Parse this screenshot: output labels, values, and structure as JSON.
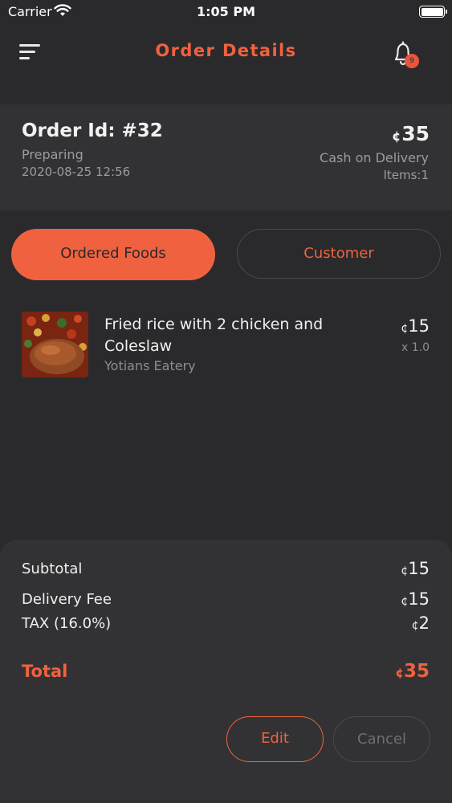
{
  "status_bar": {
    "carrier": "Carrier",
    "time": "1:05 PM",
    "icons": [
      "wifi-icon",
      "battery-icon"
    ]
  },
  "header": {
    "title": "Order Details",
    "notification_count": "9",
    "icons": [
      "menu-icon",
      "bell-icon"
    ]
  },
  "order": {
    "id_label": "Order Id: #32",
    "status": "Preparing",
    "datetime": "2020-08-25 12:56",
    "currency": "¢",
    "amount": "35",
    "payment_method": "Cash on Delivery",
    "items_count": "Items:1"
  },
  "tabs": [
    {
      "label": "Ordered Foods",
      "active": true
    },
    {
      "label": "Customer",
      "active": false
    }
  ],
  "items": [
    {
      "name": "Fried rice with 2 chicken and Coleslaw",
      "vendor": "Yotians Eatery",
      "price": "15",
      "quantity": "x 1.0"
    }
  ],
  "totals": {
    "subtotal_label": "Subtotal",
    "subtotal_value": "15",
    "delivery_label": "Delivery Fee",
    "delivery_value": "15",
    "tax_label": "TAX (16.0%)",
    "tax_value": "2",
    "total_label": "Total",
    "total_value": "35"
  },
  "actions": {
    "edit_label": "Edit",
    "cancel_label": "Cancel"
  },
  "colors": {
    "accent": "#f0623f",
    "background": "#2a2a2c",
    "card": "#323234",
    "muted_text": "#9b9b9d"
  }
}
